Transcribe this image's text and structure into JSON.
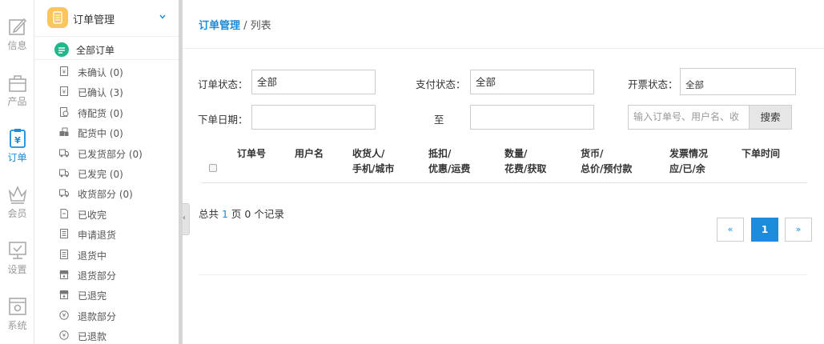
{
  "rail": {
    "items": [
      {
        "label": "信息",
        "icon": "edit-icon"
      },
      {
        "label": "产品",
        "icon": "bag-icon"
      },
      {
        "label": "订单",
        "icon": "clipboard-yen-icon",
        "active": true
      },
      {
        "label": "会员",
        "icon": "crown-icon"
      },
      {
        "label": "设置",
        "icon": "monitor-check-icon"
      },
      {
        "label": "系统",
        "icon": "gear-window-icon"
      }
    ]
  },
  "submenu": {
    "title": "订单管理",
    "all_orders": "全部订单",
    "items": [
      {
        "label": "未确认 (0)",
        "icon": "yen-doc-icon"
      },
      {
        "label": "已确认 (3)",
        "icon": "yen-doc-icon"
      },
      {
        "label": "待配货 (0)",
        "icon": "clock-doc-icon"
      },
      {
        "label": "配货中 (0)",
        "icon": "boxes-icon"
      },
      {
        "label": "已发货部分 (0)",
        "icon": "truck-icon"
      },
      {
        "label": "已发完 (0)",
        "icon": "truck-icon"
      },
      {
        "label": "收货部分 (0)",
        "icon": "truck-icon"
      },
      {
        "label": "已收完",
        "icon": "doc-icon"
      },
      {
        "label": "申请退货",
        "icon": "list-doc-icon"
      },
      {
        "label": "退货中",
        "icon": "list-doc-icon"
      },
      {
        "label": "退货部分",
        "icon": "shop-icon"
      },
      {
        "label": "已退完",
        "icon": "shop-icon"
      },
      {
        "label": "退款部分",
        "icon": "coin-icon"
      },
      {
        "label": "已退款",
        "icon": "coin-icon"
      }
    ]
  },
  "breadcrumb": {
    "main": "订单管理",
    "sep": " / ",
    "sub": "列表"
  },
  "filters": {
    "order_status_label": "订单状态：",
    "order_status_value": "全部",
    "pay_status_label": "支付状态：",
    "pay_status_value": "全部",
    "invoice_status_label": "开票状态：",
    "invoice_status_value": "全部",
    "date_label": "下单日期：",
    "date_to_label": "至",
    "search_placeholder": "输入订单号、用户名、收",
    "search_button": "搜索"
  },
  "table": {
    "headers": [
      {
        "line1": "",
        "line2": "订单号"
      },
      {
        "line1": "",
        "line2": "用户名"
      },
      {
        "line1": "收货人/",
        "line2": "手机/城市"
      },
      {
        "line1": "抵扣/",
        "line2": "优惠/运费"
      },
      {
        "line1": "数量/",
        "line2": "花费/获取"
      },
      {
        "line1": "货币/",
        "line2": "总价/预付款"
      },
      {
        "line1": "发票情况",
        "line2": "应/已/余"
      },
      {
        "line1": "",
        "line2": "下单时间"
      }
    ]
  },
  "summary": {
    "prefix": "总共 ",
    "pages": "1",
    "mid": " 页 ",
    "records": "0",
    "suffix": " 个记录"
  },
  "pagination": {
    "prev": "«",
    "current": "1",
    "next": "»"
  },
  "colors": {
    "accent": "#1c8bd9",
    "badge": "#fcc55e",
    "green": "#1fb88a"
  }
}
